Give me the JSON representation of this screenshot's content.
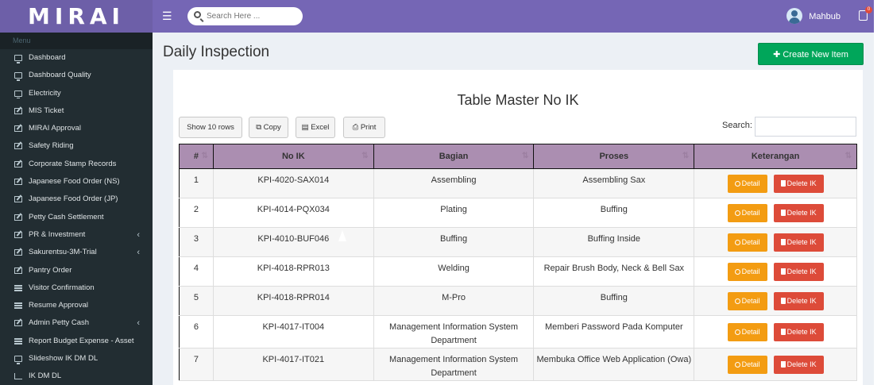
{
  "app": {
    "logo": "MIRAI"
  },
  "header": {
    "search_placeholder": "Search Here ...",
    "user_name": "Mahbub",
    "notification_count": "0"
  },
  "sidebar": {
    "menu_label": "Menu",
    "items": [
      {
        "label": "Dashboard",
        "icon": "monitor-icon",
        "chevron": ""
      },
      {
        "label": "Dashboard Quality",
        "icon": "monitor-icon",
        "chevron": ""
      },
      {
        "label": "Electricity",
        "icon": "monitor-icon",
        "chevron": ""
      },
      {
        "label": "MIS Ticket",
        "icon": "edit-icon",
        "chevron": ""
      },
      {
        "label": "MIRAI Approval",
        "icon": "edit-icon",
        "chevron": ""
      },
      {
        "label": "Safety Riding",
        "icon": "edit-icon",
        "chevron": ""
      },
      {
        "label": "Corporate Stamp Records",
        "icon": "edit-icon",
        "chevron": ""
      },
      {
        "label": "Japanese Food Order (NS)",
        "icon": "edit-icon",
        "chevron": ""
      },
      {
        "label": "Japanese Food Order (JP)",
        "icon": "edit-icon",
        "chevron": ""
      },
      {
        "label": "Petty Cash Settlement",
        "icon": "edit-icon",
        "chevron": ""
      },
      {
        "label": "PR & Investment",
        "icon": "edit-icon",
        "chevron": "‹"
      },
      {
        "label": "Sakurentsu-3M-Trial",
        "icon": "edit-icon",
        "chevron": "‹"
      },
      {
        "label": "Pantry Order",
        "icon": "edit-icon",
        "chevron": ""
      },
      {
        "label": "Visitor Confirmation",
        "icon": "list-icon",
        "chevron": ""
      },
      {
        "label": "Resume Approval",
        "icon": "list-icon",
        "chevron": ""
      },
      {
        "label": "Admin Petty Cash",
        "icon": "edit-icon",
        "chevron": "‹"
      },
      {
        "label": "Report Budget Expense - Asset",
        "icon": "list-icon",
        "chevron": ""
      },
      {
        "label": "Slideshow IK DM DL",
        "icon": "monitor-icon",
        "chevron": ""
      },
      {
        "label": "IK DM DL",
        "icon": "chart-icon",
        "chevron": ""
      }
    ]
  },
  "page": {
    "title": "Daily Inspection",
    "create_button": "✚ Create New Item"
  },
  "table": {
    "title": "Table Master No IK",
    "toolbar": {
      "show_rows": "Show 10 rows",
      "copy": "Copy",
      "excel": "Excel",
      "print": "Print",
      "search_label": "Search:"
    },
    "columns": [
      "#",
      "No IK",
      "Bagian",
      "Proses",
      "Keterangan"
    ],
    "detail_label": "Detail",
    "delete_label": "Delete IK",
    "rows": [
      {
        "num": "1",
        "no_ik": "KPI-4020-SAX014",
        "bagian": "Assembling",
        "proses": "Assembling Sax"
      },
      {
        "num": "2",
        "no_ik": "KPI-4014-PQX034",
        "bagian": "Plating",
        "proses": "Buffing"
      },
      {
        "num": "3",
        "no_ik": "KPI-4010-BUF046",
        "bagian": "Buffing",
        "proses": "Buffing Inside"
      },
      {
        "num": "4",
        "no_ik": "KPI-4018-RPR013",
        "bagian": "Welding",
        "proses": "Repair Brush Body, Neck & Bell Sax"
      },
      {
        "num": "5",
        "no_ik": "KPI-4018-RPR014",
        "bagian": "M-Pro",
        "proses": "Buffing"
      },
      {
        "num": "6",
        "no_ik": "KPI-4017-IT004",
        "bagian": "Management Information System Department",
        "proses": "Memberi Password Pada Komputer"
      },
      {
        "num": "7",
        "no_ik": "KPI-4017-IT021",
        "bagian": "Management Information System Department",
        "proses": "Membuka Office Web Application (Owa)"
      }
    ]
  }
}
